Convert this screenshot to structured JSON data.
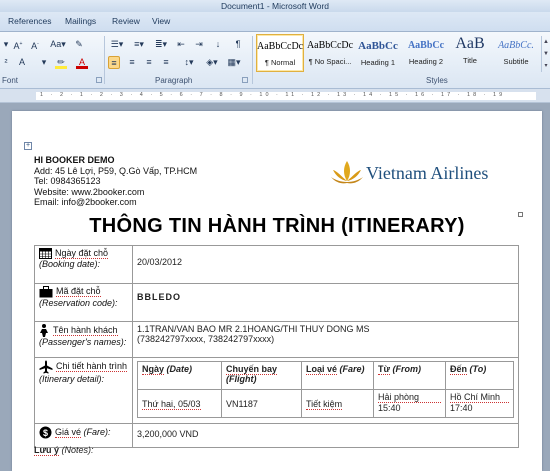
{
  "window": {
    "title": "Document1 - Microsoft Word"
  },
  "tabs": [
    "References",
    "Mailings",
    "Review",
    "View"
  ],
  "ribbon": {
    "groups": {
      "font": "Font",
      "paragraph": "Paragraph",
      "styles": "Styles"
    },
    "styles": [
      {
        "sample": "AaBbCcDc",
        "name": "¶ Normal",
        "selected": true
      },
      {
        "sample": "AaBbCcDc",
        "name": "¶ No Spaci..."
      },
      {
        "sample": "AaBbCc",
        "name": "Heading 1"
      },
      {
        "sample": "AaBbCc",
        "name": "Heading 2"
      },
      {
        "sample": "AaB",
        "name": "Title"
      },
      {
        "sample": "AaBbCc.",
        "name": "Subtitle"
      }
    ],
    "accent_color": "#fbd88a"
  },
  "ruler": {
    "numbers": "1 · 2 · 1 · 2 · 3 · 4 · 5 · 6 · 7 · 8 · 9 · 10 · 11 · 12 · 13 · 14 · 15 · 16 · 17 · 18 · 19"
  },
  "document": {
    "company": {
      "name": "HI BOOKER DEMO",
      "address": "Add: 45 Lê Lợi, P59, Q.Gò Vấp, TP.HCM",
      "tel": "Tel: 0984365123",
      "website": "Website: www.2booker.com",
      "email": "Email:  info@2booker.com"
    },
    "logo_text": "Vietnam Airlines",
    "title": "THÔNG TIN HÀNH TRÌNH (ITINERARY)",
    "rows": {
      "booking_date": {
        "label": "Ngày đặt chỗ",
        "label_en": "(Booking date):",
        "value": "20/03/2012"
      },
      "reservation_code": {
        "label": "Mã đặt chỗ",
        "label_en": "(Reservation code):",
        "value": "BBLEDO"
      },
      "passengers": {
        "label": "Tên hành khách",
        "label_en": "(Passenger's names):",
        "line1": "1.1TRAN/VAN BAO MR 2.1HOANG/THI THUY DONG MS",
        "line2": "(738242797xxxx, 738242797xxxx)"
      },
      "itinerary": {
        "label": "Chi tiết hành trình",
        "label_en": "(Itinerary detail):"
      },
      "fare": {
        "label": "Giá vé",
        "label_en": "(Fare):",
        "value": "3,200,000 VND"
      }
    },
    "flight_table": {
      "headers": [
        {
          "vi": "Ngày",
          "en": "(Date)"
        },
        {
          "vi": "Chuyến bay",
          "en": "(Flight)"
        },
        {
          "vi": "Loại vé",
          "en": "(Fare)"
        },
        {
          "vi": "Từ",
          "en": "(From)"
        },
        {
          "vi": "Đến",
          "en": "(To)"
        }
      ],
      "row": {
        "date": "Thứ hai, 05/03",
        "flight": "VN1187",
        "fare": "Tiết kiệm",
        "from_city": "Hải phòng",
        "from_time": "15:40",
        "to_city": "Hồ Chí Minh",
        "to_time": "17:40"
      }
    },
    "notes": {
      "label": "Lưu ý",
      "label_en": "(Notes):"
    }
  }
}
